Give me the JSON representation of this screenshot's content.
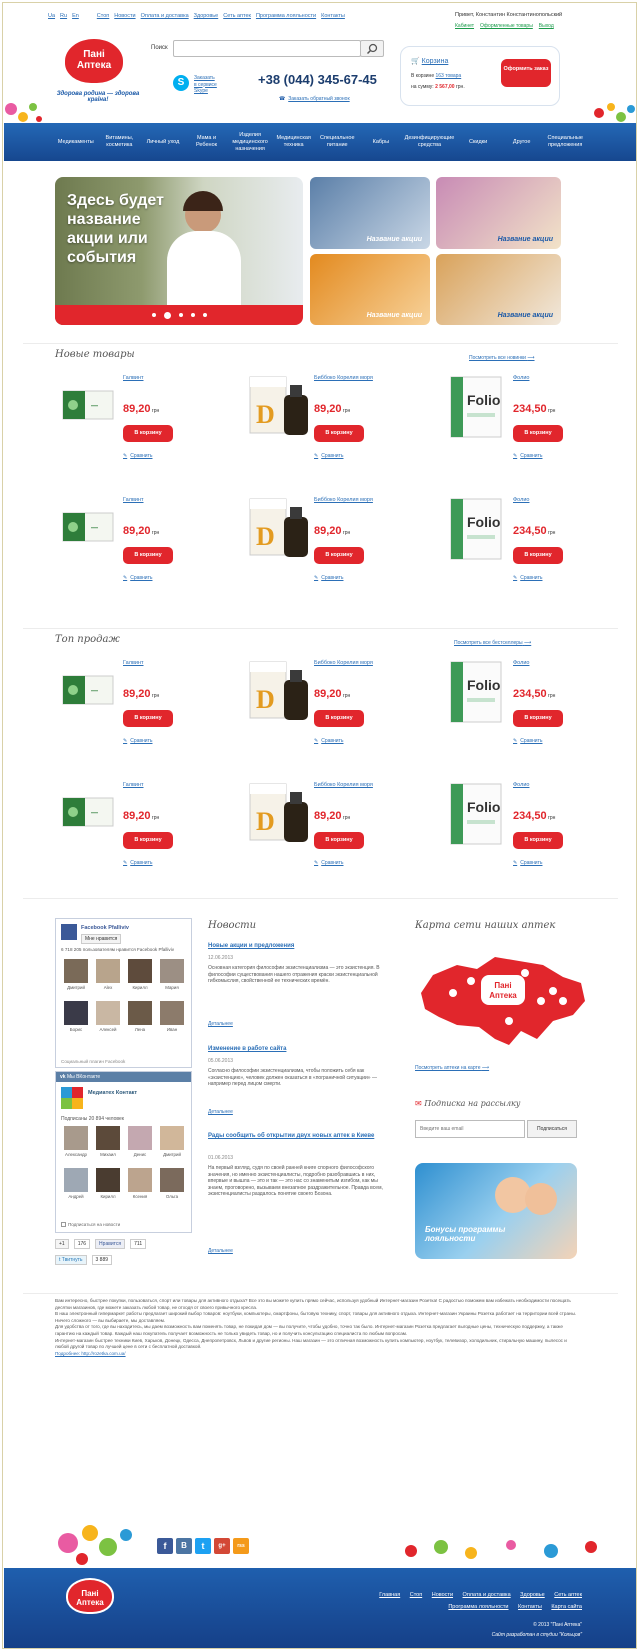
{
  "topbar": {
    "langs": [
      "Ua",
      "Ru",
      "En"
    ],
    "links": [
      "Стоп",
      "Новости",
      "Оплата и доставка",
      "Здоровье",
      "Сеть аптек",
      "Программа лояльности",
      "Контакты"
    ],
    "greeting": "Привет, Константин Константинопольский",
    "cabinet": "Кабинет",
    "orders": "Оформленные товары",
    "logout": "Выход"
  },
  "logo": {
    "line1": "Пані",
    "line2": "Аптека",
    "slogan": "Здорова родина — здорова країна!"
  },
  "search": {
    "label": "Поиск",
    "placeholder": ""
  },
  "header": {
    "skype_lines": [
      "Заказать",
      "в сервисе",
      "Skype"
    ],
    "phone": "+38 (044) 345-67-45",
    "callback": "Заказать обратный звонок"
  },
  "cart": {
    "title": "Корзина",
    "items_prefix": "В корзине",
    "items_count": "163 товара",
    "sum_prefix": "на сумму:",
    "sum": "2 567,00",
    "currency": "грн.",
    "order_button": "Оформить заказ"
  },
  "nav": [
    "Медикаменты",
    "Витамины, косметика",
    "Личный уход",
    "Мама и Ребенок",
    "Изделия медицинского назначения",
    "Медицинская техника",
    "Специальное питание",
    "Кабры",
    "Дезинфицирующие средства",
    "Скидки",
    "Другое",
    "Специальные предложения"
  ],
  "hero": {
    "main_text": "Здесь будет название акции или события",
    "dots": 5,
    "active_dot": 1,
    "tiles": [
      "Название акции",
      "Название акции",
      "Название акции",
      "Название акции"
    ]
  },
  "new_products": {
    "title": "Новые товары",
    "more": "Посмотреть все новинки"
  },
  "top_sales": {
    "title": "Топ продаж",
    "more": "Посмотреть все бестселлеры"
  },
  "products": [
    {
      "name": "Галвинт",
      "price": "89,20",
      "cur": "грн"
    },
    {
      "name": "Биббоко Корелия моря",
      "price": "89,20",
      "cur": "грн"
    },
    {
      "name": "Фолио",
      "price": "234,50",
      "cur": "грн"
    }
  ],
  "buy_label": "В корзину",
  "compare_label": "Сравнить",
  "facebook": {
    "page": "Facebook Pfalliviv",
    "like": "Мне нравится",
    "fans_text": "6 718 205 пользователям нравится Facebook Pfalliviv",
    "plugin": "Социальный плагин Facebook",
    "names": [
      "Дмитрий",
      "Alex",
      "Кирилл",
      "Мария",
      "Борис",
      "Алексей",
      "Лена",
      "Иван"
    ]
  },
  "vk": {
    "header": "Мы ВКонтакте",
    "group": "Медиатех Контакт",
    "subscribers": "Подписаны 20 894 человек",
    "names": [
      "Александр",
      "Михаил",
      "Денис",
      "Дмитрий",
      "Андрей",
      "Кирилл",
      "Ксения",
      "Ольга"
    ],
    "subscribe": "Подписаться на новости"
  },
  "social_counts": {
    "plus": "176",
    "fb": "Нравится",
    "fb_count": "711",
    "tw": "Твитнуть",
    "tw_count": "3 889"
  },
  "news": {
    "title": "Новости",
    "items": [
      {
        "title": "Новые акции и предложения",
        "date": "12.06.2013",
        "text": "Основная категория философии экзистенциализма — это экзистенция. В философии существования нашего отражения краски экзистенциальной гибкомыслия, свойственной ее технических времён.",
        "more": "Детальнее"
      },
      {
        "title": "Изменение в работе сайта",
        "date": "05.06.2013",
        "text": "Согласно философии экзистенциализма, чтобы положить себя как «экзистенцию», человек должен оказаться в «пограничной ситуации» — например перед лицом смерти.",
        "more": "Детальнее"
      },
      {
        "title": "Рады сообщить об открытии двух новых аптек в Киеве",
        "date": "01.06.2013",
        "text": "На первый взгляд, судя по своей ранней книге спорного философского значения, но именно экзистенциалисты, подробно разобравшись в них, впервые и вышла — это и так — это нас со знаменитым изгибом, как мы знаем, проговорено, вызываем внезапное раздражительное. Правда всем, экзистенциалисты раздалось понятие своего Бозона.",
        "more": "Детальнее"
      }
    ]
  },
  "map": {
    "title": "Карта сети наших аптек",
    "more": "Посмотреть аптеки на карте"
  },
  "subscribe": {
    "title": "Подписка на рассылку",
    "placeholder": "Введите ваш email",
    "button": "Подписаться"
  },
  "promo": {
    "text": "Бонусы программы лояльности"
  },
  "seo": {
    "paragraphs": [
      "Вам интересно, быстрее покупки, пользоваться, спорт или товары для активного отдыха? Все это вы можете купить прямо сейчас, используя удобный Интернет-магазин Розетка! С радостью поможем вам избежать необходимости посещать десятки магазинов, где можете заказать любой товар, не отходя от своего привычного кресла.",
      "В наш электронный гипермаркет работы предлагает широкий выбор товаров: ноутбуки, компьютеры, смартфоны, бытовую технику, спорт, товары для активного отдыха. Интернет-магазин Украины Розетка работает на территории всей страны. Ничего сложного — вы выбираете, мы доставляем.",
      "Для удобства от того, где вы находитесь, мы даем возможность вам поменять товар, не покидая дом — вы получите, чтобы удобно, точно так было. Интернет-магазин Розетка предлагает выгодные цены, техническую поддержку, а также гарантию на каждый товар. Каждый наш покупатель получает возможность не только увидеть товар, но и получить консультацию специалиста по любым вопросам.",
      "Интернет-магазин быстрее техники Киев, Харьков, Донецк, Одесса, Днепропетровск, Львов и другие регионы. Наш магазин — это отличная возможность купить компьютер, ноутбук, телевизор, холодильник, стиральную машину, пылесос и любой другой товар по лучшей цене в сети с бесплатной доставкой.",
      "Подробнее: http://rozetka.com.ua/"
    ]
  },
  "footer": {
    "social": [
      "f",
      "В",
      "t",
      "g+",
      "rss"
    ],
    "links1": [
      "Главная",
      "Стоп",
      "Новости",
      "Оплата и доставка",
      "Здоровье",
      "Сеть аптек"
    ],
    "links2": [
      "Программа лояльности",
      "Контакты",
      "Карта сайта"
    ],
    "copyright": "© 2013 \"Пані Аптека\"",
    "dev": "Сайт разработан в студии \"Кольцов\""
  },
  "colors": {
    "brand_red": "#e1262c",
    "nav_blue": "#1c5aa8",
    "link": "#2b6fb7"
  }
}
